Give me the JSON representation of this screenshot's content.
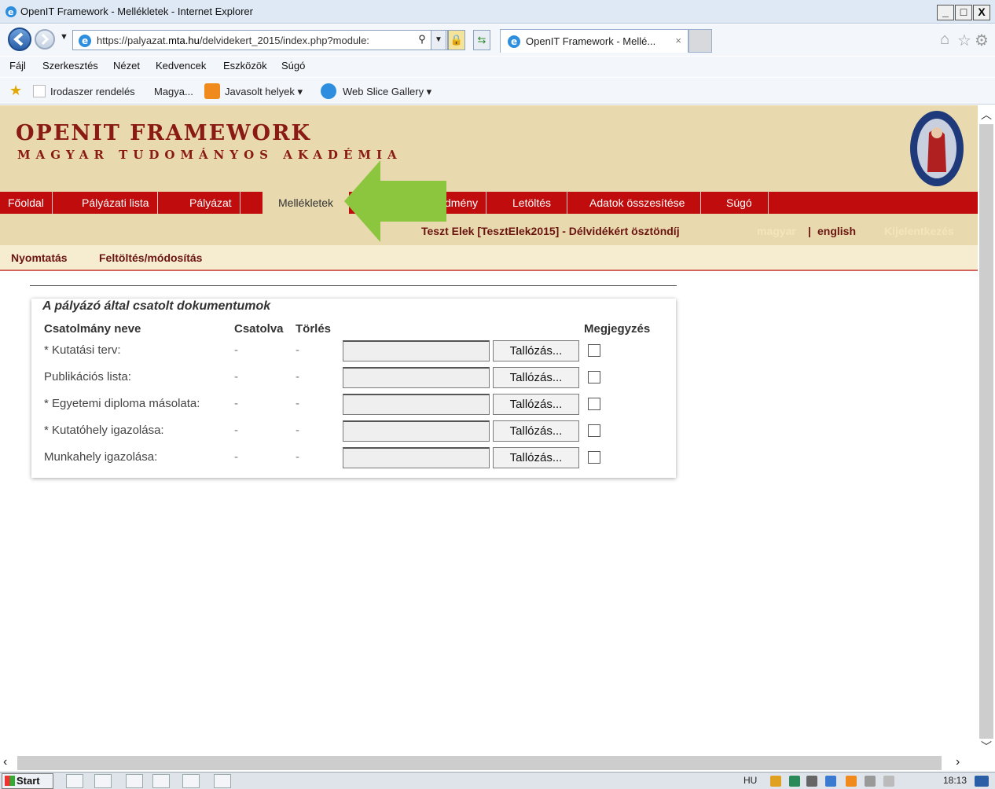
{
  "window": {
    "title": "OpenIT Framework - Mellékletek - Internet Explorer",
    "min": "_",
    "max": "□",
    "close": "X"
  },
  "browser": {
    "url_prefix": "https://palyazat.",
    "url_domain": "mta.hu",
    "url_rest": "/delvidekert_2015/index.php?module:",
    "tab_title": "OpenIT Framework - Mellé...",
    "tab_close": "×"
  },
  "menu": [
    "Fájl",
    "Szerkesztés",
    "Nézet",
    "Kedvencek",
    "Eszközök",
    "Súgó"
  ],
  "favorites": {
    "item1": "Irodaszer rendelés",
    "item2": "Magya...",
    "item3": "Javasolt helyek ▾",
    "item4": "Web Slice Gallery ▾"
  },
  "site": {
    "logo_line1": "OPENIT FRAMEWORK",
    "logo_line2": "MAGYAR TUDOMÁNYOS AKADÉMIA"
  },
  "nav": [
    {
      "label": "Főoldal"
    },
    {
      "label": "Pályázati lista"
    },
    {
      "label": "Pályázat"
    },
    {
      "label": "Mellékletek",
      "active": true
    },
    {
      "label": "dmény"
    },
    {
      "label": "Letöltés"
    },
    {
      "label": "Adatok összesítése"
    },
    {
      "label": "Súgó"
    }
  ],
  "userbar": {
    "user": "Teszt Elek [TesztElek2015] - Délvidékért ösztöndíj",
    "lang_hu": "magyar",
    "separator": "|",
    "lang_en": "english",
    "logout": "Kijelentkezés"
  },
  "subnav": {
    "print": "Nyomtatás",
    "upload": "Feltöltés/módosítás"
  },
  "attachments": {
    "title": "A pályázó által csatolt dokumentumok",
    "headers": {
      "name": "Csatolmány neve",
      "attached": "Csatolva",
      "delete": "Törlés",
      "note": "Megjegyzés"
    },
    "browse_label": "Tallózás...",
    "rows": [
      {
        "name": "* Kutatási terv:",
        "attached": "-",
        "delete": "-"
      },
      {
        "name": "Publikációs lista:",
        "attached": "-",
        "delete": "-"
      },
      {
        "name": "* Egyetemi diploma másolata:",
        "attached": "-",
        "delete": "-"
      },
      {
        "name": "* Kutatóhely igazolása:",
        "attached": "-",
        "delete": "-"
      },
      {
        "name": "Munkahely igazolása:",
        "attached": "-",
        "delete": "-"
      }
    ]
  },
  "taskbar": {
    "start": "Start",
    "lang": "HU",
    "time": "18:13"
  },
  "colors": {
    "nav_red": "#c00c0c",
    "header_beige": "#e8d9ae",
    "brand_dark_red": "#8a1a14",
    "arrow_green": "#8cc63f"
  }
}
